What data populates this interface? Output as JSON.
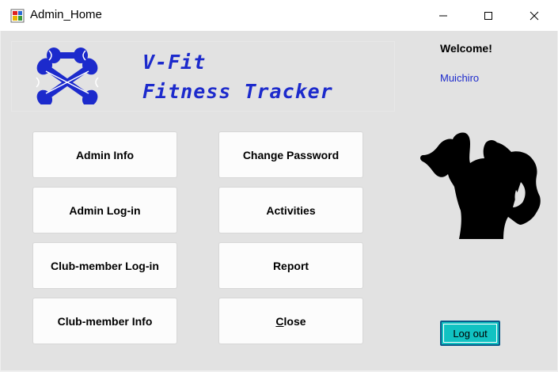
{
  "window": {
    "title": "Admin_Home",
    "controls": [
      "minimize-icon",
      "maximize-icon",
      "close-icon"
    ]
  },
  "logo": {
    "icon": "dumbbell-icon",
    "line1": "V-Fit",
    "line2": "Fitness Tracker",
    "brand_color": "#1c2acc"
  },
  "buttons": {
    "admin_info": "Admin Info",
    "change_password": "Change Password",
    "admin_login": "Admin Log-in",
    "activities": "Activities",
    "club_member_login": "Club-member Log-in",
    "report": "Report",
    "club_member_info": "Club-member Info",
    "close_first": "C",
    "close_rest": "lose"
  },
  "sidebar": {
    "welcome": "Welcome!",
    "username": "Muichiro",
    "illustration": "bodybuilder-silhouette",
    "logout_label": "Log out",
    "logout_color": "#11c2c2"
  }
}
